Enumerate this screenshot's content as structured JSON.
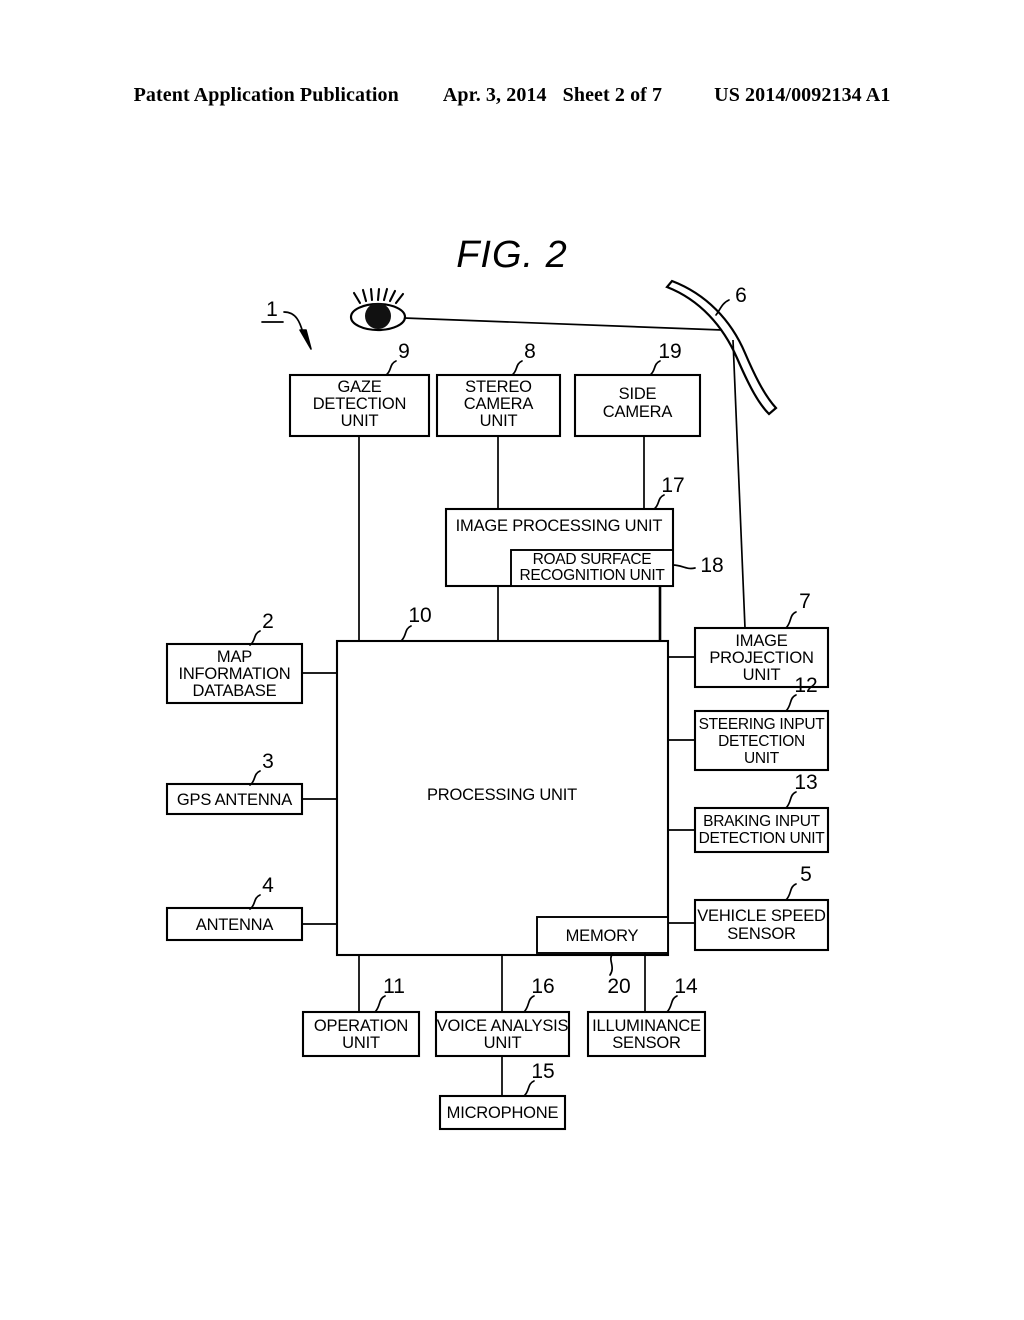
{
  "header": {
    "publication": "Patent Application Publication",
    "date": "Apr. 3, 2014",
    "sheet": "Sheet 2 of 7",
    "number": "US 2014/0092134 A1"
  },
  "figure": {
    "title": "FIG. 2"
  },
  "diagram": {
    "system_ref": "1",
    "windshield_ref": "6",
    "boxes": [
      {
        "id": "gaze-detection-unit",
        "ref": "9",
        "lines": [
          "GAZE",
          "DETECTION",
          "UNIT"
        ]
      },
      {
        "id": "stereo-camera-unit",
        "ref": "8",
        "lines": [
          "STEREO",
          "CAMERA",
          "UNIT"
        ]
      },
      {
        "id": "side-camera",
        "ref": "19",
        "lines": [
          "SIDE",
          "CAMERA"
        ]
      },
      {
        "id": "image-processing-unit",
        "ref": "17",
        "lines": [
          "IMAGE PROCESSING UNIT"
        ]
      },
      {
        "id": "road-surface-recognition-unit",
        "ref": "18",
        "lines": [
          "ROAD SURFACE",
          "RECOGNITION UNIT"
        ]
      },
      {
        "id": "image-projection-unit",
        "ref": "7",
        "lines": [
          "IMAGE",
          "PROJECTION",
          "UNIT"
        ]
      },
      {
        "id": "steering-input-detection-unit",
        "ref": "12",
        "lines": [
          "STEERING INPUT",
          "DETECTION",
          "UNIT"
        ]
      },
      {
        "id": "braking-input-detection-unit",
        "ref": "13",
        "lines": [
          "BRAKING INPUT",
          "DETECTION UNIT"
        ]
      },
      {
        "id": "vehicle-speed-sensor",
        "ref": "5",
        "lines": [
          "VEHICLE SPEED",
          "SENSOR"
        ]
      },
      {
        "id": "map-information-database",
        "ref": "2",
        "lines": [
          "MAP",
          "INFORMATION",
          "DATABASE"
        ]
      },
      {
        "id": "gps-antenna",
        "ref": "3",
        "lines": [
          "GPS ANTENNA"
        ]
      },
      {
        "id": "antenna",
        "ref": "4",
        "lines": [
          "ANTENNA"
        ]
      },
      {
        "id": "processing-unit",
        "ref": "10",
        "lines": [
          "PROCESSING UNIT"
        ]
      },
      {
        "id": "memory",
        "ref": "20",
        "lines": [
          "MEMORY"
        ]
      },
      {
        "id": "operation-unit",
        "ref": "11",
        "lines": [
          "OPERATION",
          "UNIT"
        ]
      },
      {
        "id": "voice-analysis-unit",
        "ref": "16",
        "lines": [
          "VOICE ANALYSIS",
          "UNIT"
        ]
      },
      {
        "id": "illuminance-sensor",
        "ref": "14",
        "lines": [
          "ILLUMINANCE",
          "SENSOR"
        ]
      },
      {
        "id": "microphone",
        "ref": "15",
        "lines": [
          "MICROPHONE"
        ]
      }
    ]
  }
}
